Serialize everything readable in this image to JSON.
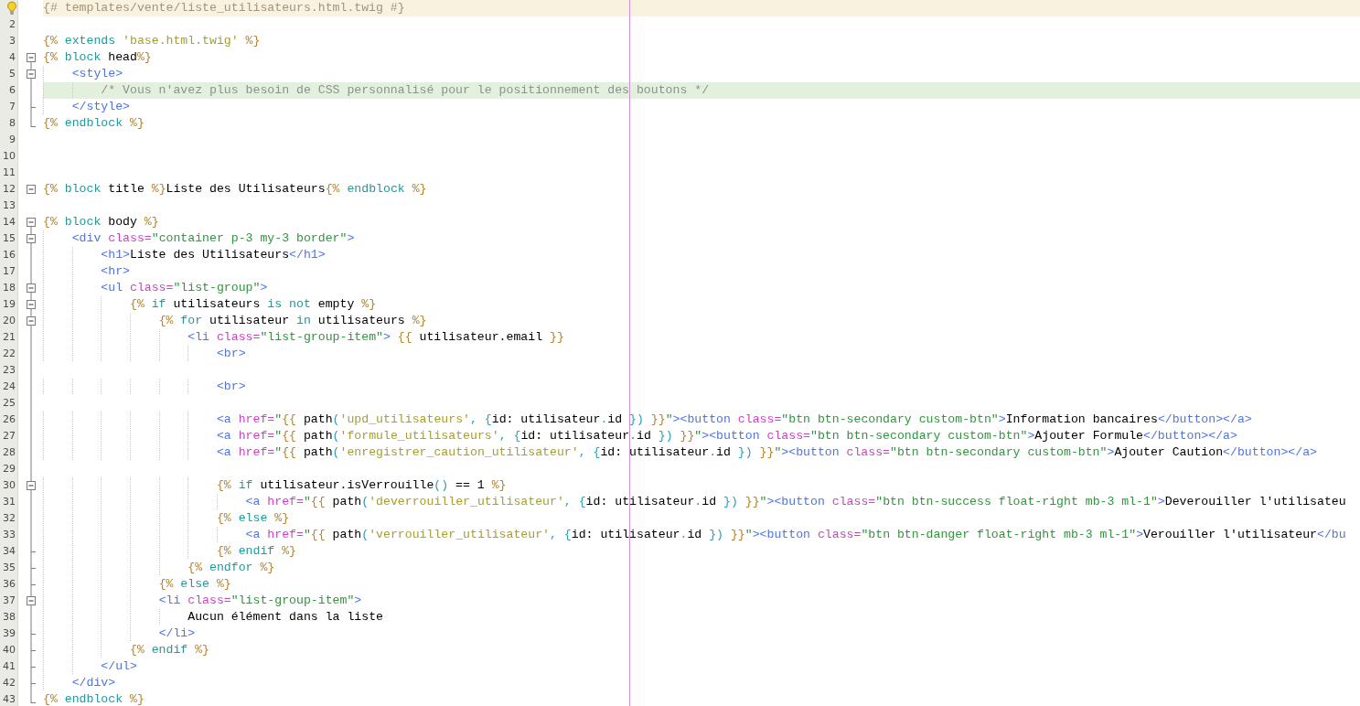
{
  "editor": {
    "lines": [
      {
        "hint": true,
        "current": true,
        "tokens": [
          {
            "kind": "twig-comment",
            "text": "{# templates/vente/liste_utilisateurs.html.twig #}"
          }
        ]
      },
      {
        "number": "2"
      },
      {
        "number": "3",
        "tokens": [
          {
            "kind": "delimiter",
            "text": "{%"
          },
          {
            "kind": "keyword",
            "text": " extends "
          },
          {
            "kind": "string",
            "text": "'base.html.twig'"
          },
          {
            "kind": "delimiter",
            "text": " %}"
          }
        ]
      },
      {
        "number": "4",
        "fold": {
          "kind": "start",
          "expanded": true
        },
        "tokens": [
          {
            "kind": "delimiter",
            "text": "{%"
          },
          {
            "kind": "keyword",
            "text": " block "
          },
          {
            "kind": "plain",
            "text": "head"
          },
          {
            "kind": "delimiter",
            "text": "%}"
          }
        ]
      },
      {
        "number": "5",
        "fold": {
          "kind": "inner",
          "expanded": true
        },
        "tokens": [
          {
            "kind": "tag",
            "text": "    <style>"
          }
        ]
      },
      {
        "number": "6",
        "fold": {
          "kind": "line"
        },
        "highlighted": true,
        "tokens": [
          {
            "kind": "comment",
            "text": "        /* Vous n'avez plus besoin de CSS personnalisé pour le positionnement des boutons */"
          }
        ]
      },
      {
        "number": "7",
        "fold": {
          "kind": "tick"
        },
        "tokens": [
          {
            "kind": "tag",
            "text": "    </style>"
          }
        ]
      },
      {
        "number": "8",
        "fold": {
          "kind": "end"
        },
        "tokens": [
          {
            "kind": "delimiter",
            "text": "{%"
          },
          {
            "kind": "keyword",
            "text": " endblock "
          },
          {
            "kind": "delimiter",
            "text": "%}"
          }
        ]
      },
      {
        "number": "9"
      },
      {
        "number": "10"
      },
      {
        "number": "11"
      },
      {
        "number": "12",
        "fold": {
          "kind": "alone",
          "expanded": true
        },
        "tokens": [
          {
            "kind": "delimiter",
            "text": "{%"
          },
          {
            "kind": "keyword",
            "text": " block "
          },
          {
            "kind": "plain",
            "text": "title "
          },
          {
            "kind": "delimiter",
            "text": "%}"
          },
          {
            "kind": "plain",
            "text": "Liste des Utilisateurs"
          },
          {
            "kind": "delimiter",
            "text": "{%"
          },
          {
            "kind": "keyword",
            "text": " endblock "
          },
          {
            "kind": "delimiter",
            "text": "%}"
          }
        ]
      },
      {
        "number": "13"
      },
      {
        "number": "14",
        "fold": {
          "kind": "start",
          "expanded": true
        },
        "tokens": [
          {
            "kind": "delimiter",
            "text": "{%"
          },
          {
            "kind": "keyword",
            "text": " block "
          },
          {
            "kind": "plain",
            "text": "body "
          },
          {
            "kind": "delimiter",
            "text": "%}"
          }
        ]
      },
      {
        "number": "15",
        "fold": {
          "kind": "inner",
          "expanded": true
        },
        "tokens": [
          {
            "kind": "tag",
            "text": "    <div "
          },
          {
            "kind": "attribute",
            "text": "class="
          },
          {
            "kind": "value",
            "text": "\"container p-3 my-3 border\""
          },
          {
            "kind": "tag",
            "text": ">"
          }
        ]
      },
      {
        "number": "16",
        "fold": {
          "kind": "line"
        },
        "tokens": [
          {
            "kind": "tag",
            "text": "        <h1>"
          },
          {
            "kind": "plain",
            "text": "Liste des Utilisateurs"
          },
          {
            "kind": "tag",
            "text": "</h1>"
          }
        ]
      },
      {
        "number": "17",
        "fold": {
          "kind": "line"
        },
        "tokens": [
          {
            "kind": "tag",
            "text": "        <hr>"
          }
        ]
      },
      {
        "number": "18",
        "fold": {
          "kind": "inner",
          "expanded": true
        },
        "tokens": [
          {
            "kind": "tag",
            "text": "        <ul "
          },
          {
            "kind": "attribute",
            "text": "class="
          },
          {
            "kind": "value",
            "text": "\"list-group\""
          },
          {
            "kind": "tag",
            "text": ">"
          }
        ]
      },
      {
        "number": "19",
        "fold": {
          "kind": "inner",
          "expanded": true
        },
        "tokens": [
          {
            "kind": "delimiter",
            "text": "            {%"
          },
          {
            "kind": "keyword",
            "text": " if "
          },
          {
            "kind": "plain",
            "text": "utilisateurs "
          },
          {
            "kind": "keyword",
            "text": "is not "
          },
          {
            "kind": "plain",
            "text": "empty "
          },
          {
            "kind": "delimiter",
            "text": "%}"
          }
        ]
      },
      {
        "number": "20",
        "fold": {
          "kind": "inner",
          "expanded": true
        },
        "tokens": [
          {
            "kind": "delimiter",
            "text": "                {%"
          },
          {
            "kind": "keyword",
            "text": " for "
          },
          {
            "kind": "plain",
            "text": "utilisateur "
          },
          {
            "kind": "keyword",
            "text": "in "
          },
          {
            "kind": "plain",
            "text": "utilisateurs "
          },
          {
            "kind": "delimiter",
            "text": "%}"
          }
        ]
      },
      {
        "number": "21",
        "fold": {
          "kind": "line"
        },
        "tokens": [
          {
            "kind": "tag",
            "text": "                    <li "
          },
          {
            "kind": "attribute",
            "text": "class="
          },
          {
            "kind": "value",
            "text": "\"list-group-item\""
          },
          {
            "kind": "tag",
            "text": ">"
          },
          {
            "kind": "delimiter",
            "text": " {{ "
          },
          {
            "kind": "plain",
            "text": "utilisateur.email "
          },
          {
            "kind": "delimiter",
            "text": "}}"
          }
        ]
      },
      {
        "number": "22",
        "fold": {
          "kind": "line"
        },
        "tokens": [
          {
            "kind": "tag",
            "text": "                        <br>"
          }
        ]
      },
      {
        "number": "23",
        "fold": {
          "kind": "line"
        }
      },
      {
        "number": "24",
        "fold": {
          "kind": "line"
        },
        "tokens": [
          {
            "kind": "tag",
            "text": "                        <br>"
          }
        ]
      },
      {
        "number": "25",
        "fold": {
          "kind": "line"
        }
      },
      {
        "number": "26",
        "fold": {
          "kind": "line"
        },
        "tokens": [
          {
            "kind": "tag",
            "text": "                        <a "
          },
          {
            "kind": "attribute",
            "text": "href="
          },
          {
            "kind": "value",
            "text": "\""
          },
          {
            "kind": "delimiter",
            "text": "{{ "
          },
          {
            "kind": "plain",
            "text": "path"
          },
          {
            "kind": "operator",
            "text": "("
          },
          {
            "kind": "string",
            "text": "'upd_utilisateurs'"
          },
          {
            "kind": "operator",
            "text": ", {"
          },
          {
            "kind": "plain",
            "text": "id: utilisateur"
          },
          {
            "kind": "operator",
            "text": "."
          },
          {
            "kind": "plain",
            "text": "id "
          },
          {
            "kind": "operator",
            "text": "})"
          },
          {
            "kind": "delimiter",
            "text": " }}"
          },
          {
            "kind": "value",
            "text": "\""
          },
          {
            "kind": "tag",
            "text": "><button "
          },
          {
            "kind": "attribute",
            "text": "class="
          },
          {
            "kind": "value",
            "text": "\"btn btn-secondary custom-btn\""
          },
          {
            "kind": "tag",
            "text": ">"
          },
          {
            "kind": "plain",
            "text": "Information bancaires"
          },
          {
            "kind": "tag",
            "text": "</button></a>"
          }
        ]
      },
      {
        "number": "27",
        "fold": {
          "kind": "line"
        },
        "tokens": [
          {
            "kind": "tag",
            "text": "                        <a "
          },
          {
            "kind": "attribute",
            "text": "href="
          },
          {
            "kind": "value",
            "text": "\""
          },
          {
            "kind": "delimiter",
            "text": "{{ "
          },
          {
            "kind": "plain",
            "text": "path"
          },
          {
            "kind": "operator",
            "text": "("
          },
          {
            "kind": "string",
            "text": "'formule_utilisateurs'"
          },
          {
            "kind": "operator",
            "text": ", {"
          },
          {
            "kind": "plain",
            "text": "id: utilisateur"
          },
          {
            "kind": "operator",
            "text": "."
          },
          {
            "kind": "plain",
            "text": "id "
          },
          {
            "kind": "operator",
            "text": "})"
          },
          {
            "kind": "delimiter",
            "text": " }}"
          },
          {
            "kind": "value",
            "text": "\""
          },
          {
            "kind": "tag",
            "text": "><button "
          },
          {
            "kind": "attribute",
            "text": "class="
          },
          {
            "kind": "value",
            "text": "\"btn btn-secondary custom-btn\""
          },
          {
            "kind": "tag",
            "text": ">"
          },
          {
            "kind": "plain",
            "text": "Ajouter Formule"
          },
          {
            "kind": "tag",
            "text": "</button></a>"
          }
        ]
      },
      {
        "number": "28",
        "fold": {
          "kind": "line"
        },
        "tokens": [
          {
            "kind": "tag",
            "text": "                        <a "
          },
          {
            "kind": "attribute",
            "text": "href="
          },
          {
            "kind": "value",
            "text": "\""
          },
          {
            "kind": "delimiter",
            "text": "{{ "
          },
          {
            "kind": "plain",
            "text": "path"
          },
          {
            "kind": "operator",
            "text": "("
          },
          {
            "kind": "string",
            "text": "'enregistrer_caution_utilisateur'"
          },
          {
            "kind": "operator",
            "text": ", {"
          },
          {
            "kind": "plain",
            "text": "id: utilisateur"
          },
          {
            "kind": "operator",
            "text": "."
          },
          {
            "kind": "plain",
            "text": "id "
          },
          {
            "kind": "operator",
            "text": "})"
          },
          {
            "kind": "delimiter",
            "text": " }}"
          },
          {
            "kind": "value",
            "text": "\""
          },
          {
            "kind": "tag",
            "text": "><button "
          },
          {
            "kind": "attribute",
            "text": "class="
          },
          {
            "kind": "value",
            "text": "\"btn btn-secondary custom-btn\""
          },
          {
            "kind": "tag",
            "text": ">"
          },
          {
            "kind": "plain",
            "text": "Ajouter Caution"
          },
          {
            "kind": "tag",
            "text": "</button></a>"
          }
        ]
      },
      {
        "number": "29",
        "fold": {
          "kind": "line"
        }
      },
      {
        "number": "30",
        "fold": {
          "kind": "inner",
          "expanded": true
        },
        "tokens": [
          {
            "kind": "delimiter",
            "text": "                        {%"
          },
          {
            "kind": "keyword",
            "text": " if "
          },
          {
            "kind": "plain",
            "text": "utilisateur.isVerrouille"
          },
          {
            "kind": "operator",
            "text": "()"
          },
          {
            "kind": "plain",
            "text": " == 1 "
          },
          {
            "kind": "delimiter",
            "text": "%}"
          }
        ]
      },
      {
        "number": "31",
        "fold": {
          "kind": "line"
        },
        "tokens": [
          {
            "kind": "tag",
            "text": "                            <a "
          },
          {
            "kind": "attribute",
            "text": "href="
          },
          {
            "kind": "value",
            "text": "\""
          },
          {
            "kind": "delimiter",
            "text": "{{ "
          },
          {
            "kind": "plain",
            "text": "path"
          },
          {
            "kind": "operator",
            "text": "("
          },
          {
            "kind": "string",
            "text": "'deverrouiller_utilisateur'"
          },
          {
            "kind": "operator",
            "text": ", {"
          },
          {
            "kind": "plain",
            "text": "id: utilisateur"
          },
          {
            "kind": "operator",
            "text": "."
          },
          {
            "kind": "plain",
            "text": "id "
          },
          {
            "kind": "operator",
            "text": "})"
          },
          {
            "kind": "delimiter",
            "text": " }}"
          },
          {
            "kind": "value",
            "text": "\""
          },
          {
            "kind": "tag",
            "text": "><button "
          },
          {
            "kind": "attribute",
            "text": "class="
          },
          {
            "kind": "value",
            "text": "\"btn btn-success float-right mb-3 ml-1\""
          },
          {
            "kind": "tag",
            "text": ">"
          },
          {
            "kind": "plain",
            "text": "Deverouiller l'utilisateu"
          }
        ]
      },
      {
        "number": "32",
        "fold": {
          "kind": "line"
        },
        "tokens": [
          {
            "kind": "delimiter",
            "text": "                        {%"
          },
          {
            "kind": "keyword",
            "text": " else "
          },
          {
            "kind": "delimiter",
            "text": "%}"
          }
        ]
      },
      {
        "number": "33",
        "fold": {
          "kind": "line"
        },
        "tokens": [
          {
            "kind": "tag",
            "text": "                            <a "
          },
          {
            "kind": "attribute",
            "text": "href="
          },
          {
            "kind": "value",
            "text": "\""
          },
          {
            "kind": "delimiter",
            "text": "{{ "
          },
          {
            "kind": "plain",
            "text": "path"
          },
          {
            "kind": "operator",
            "text": "("
          },
          {
            "kind": "string",
            "text": "'verrouiller_utilisateur'"
          },
          {
            "kind": "operator",
            "text": ", {"
          },
          {
            "kind": "plain",
            "text": "id: utilisateur"
          },
          {
            "kind": "operator",
            "text": "."
          },
          {
            "kind": "plain",
            "text": "id "
          },
          {
            "kind": "operator",
            "text": "})"
          },
          {
            "kind": "delimiter",
            "text": " }}"
          },
          {
            "kind": "value",
            "text": "\""
          },
          {
            "kind": "tag",
            "text": "><button "
          },
          {
            "kind": "attribute",
            "text": "class="
          },
          {
            "kind": "value",
            "text": "\"btn btn-danger float-right mb-3 ml-1\""
          },
          {
            "kind": "tag",
            "text": ">"
          },
          {
            "kind": "plain",
            "text": "Verouiller l'utilisateur"
          },
          {
            "kind": "tag",
            "text": "</bu"
          }
        ]
      },
      {
        "number": "34",
        "fold": {
          "kind": "tick"
        },
        "tokens": [
          {
            "kind": "delimiter",
            "text": "                        {%"
          },
          {
            "kind": "keyword",
            "text": " endif "
          },
          {
            "kind": "delimiter",
            "text": "%}"
          }
        ]
      },
      {
        "number": "35",
        "fold": {
          "kind": "tick"
        },
        "tokens": [
          {
            "kind": "delimiter",
            "text": "                    {%"
          },
          {
            "kind": "keyword",
            "text": " endfor "
          },
          {
            "kind": "delimiter",
            "text": "%}"
          }
        ]
      },
      {
        "number": "36",
        "fold": {
          "kind": "tick"
        },
        "tokens": [
          {
            "kind": "delimiter",
            "text": "                {%"
          },
          {
            "kind": "keyword",
            "text": " else "
          },
          {
            "kind": "delimiter",
            "text": "%}"
          }
        ]
      },
      {
        "number": "37",
        "fold": {
          "kind": "inner",
          "expanded": true
        },
        "tokens": [
          {
            "kind": "tag",
            "text": "                <li "
          },
          {
            "kind": "attribute",
            "text": "class="
          },
          {
            "kind": "value",
            "text": "\"list-group-item\""
          },
          {
            "kind": "tag",
            "text": ">"
          }
        ]
      },
      {
        "number": "38",
        "fold": {
          "kind": "line"
        },
        "tokens": [
          {
            "kind": "plain",
            "text": "                    Aucun élément dans la liste"
          }
        ]
      },
      {
        "number": "39",
        "fold": {
          "kind": "tick"
        },
        "tokens": [
          {
            "kind": "tag",
            "text": "                </li>"
          }
        ]
      },
      {
        "number": "40",
        "fold": {
          "kind": "tick"
        },
        "tokens": [
          {
            "kind": "delimiter",
            "text": "            {%"
          },
          {
            "kind": "keyword",
            "text": " endif "
          },
          {
            "kind": "delimiter",
            "text": "%}"
          }
        ]
      },
      {
        "number": "41",
        "fold": {
          "kind": "tick"
        },
        "tokens": [
          {
            "kind": "tag",
            "text": "        </ul>"
          }
        ]
      },
      {
        "number": "42",
        "fold": {
          "kind": "tick"
        },
        "tokens": [
          {
            "kind": "tag",
            "text": "    </div>"
          }
        ]
      },
      {
        "number": "43",
        "fold": {
          "kind": "end"
        },
        "tokens": [
          {
            "kind": "delimiter",
            "text": "{%"
          },
          {
            "kind": "keyword",
            "text": " endblock "
          },
          {
            "kind": "delimiter",
            "text": "%}"
          }
        ]
      }
    ]
  }
}
